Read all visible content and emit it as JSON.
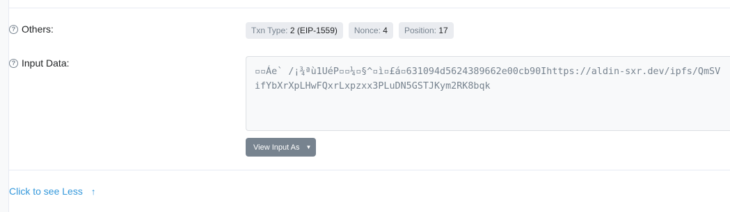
{
  "others": {
    "label": "Others:",
    "badges": [
      {
        "key": "Txn Type:",
        "value": "2 (EIP-1559)"
      },
      {
        "key": "Nonce:",
        "value": "4"
      },
      {
        "key": "Position:",
        "value": "17"
      }
    ]
  },
  "input_data": {
    "label": "Input Data:",
    "value": "▫▫Áe` /¡¾ªù1UéP▫▫¼▫§^▫ì▫£á▫631094d5624389662e00cb90Ihttps://aldin-sxr.dev/ipfs/QmSVifYbXrXpLHwFQxrLxpzxx3PLuDN5GSTJKym2RK8bqk",
    "view_button_label": "View Input As"
  },
  "footer": {
    "toggle_label": "Click to see Less"
  },
  "icons": {
    "help": "question-circle-icon",
    "dropdown": "caret-down-icon",
    "arrow": "arrow-up-icon"
  },
  "colors": {
    "link": "#3498db",
    "badge_bg": "#eaecf0",
    "button_bg": "#77838f"
  }
}
